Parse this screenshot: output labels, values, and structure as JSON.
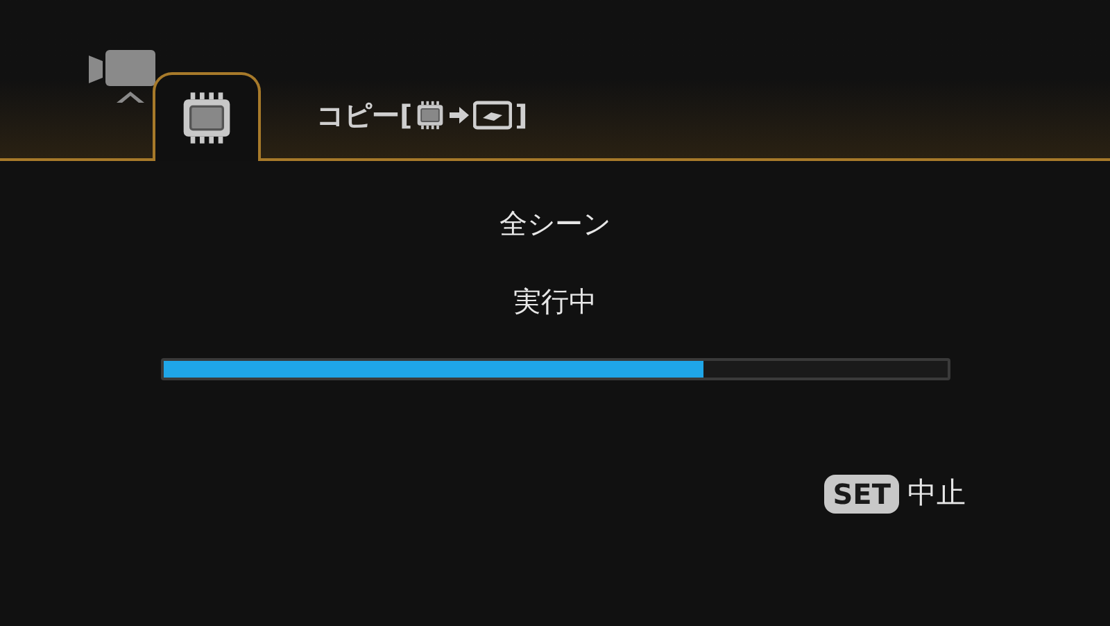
{
  "tabs": [
    {
      "kind": "movie",
      "selected": false
    },
    {
      "kind": "memory",
      "selected": true
    }
  ],
  "header": {
    "title_start": "コピー[",
    "title_end": "]"
  },
  "scenes": "全シーン",
  "status": "実行中",
  "progress": {
    "level": 0.69
  },
  "cancel": {
    "key": "SET",
    "label": "中止"
  }
}
